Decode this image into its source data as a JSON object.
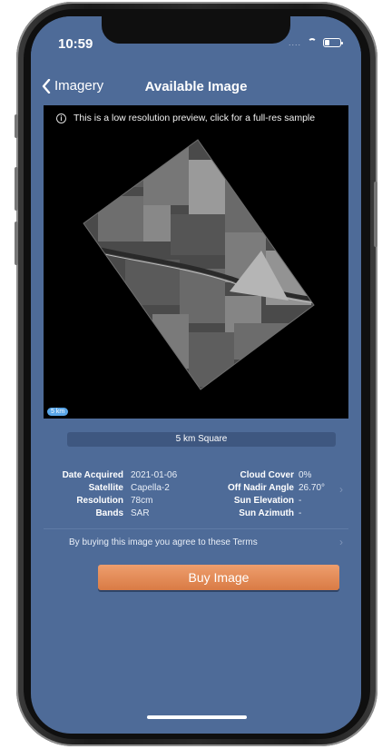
{
  "status_bar": {
    "time": "10:59",
    "signal_dots": "....",
    "icons": [
      "wifi-icon",
      "battery-icon"
    ]
  },
  "nav": {
    "back_label": "Imagery",
    "title": "Available Image"
  },
  "preview": {
    "note": "This is a low resolution preview, click for a full-res sample",
    "scale_badge": "5 km"
  },
  "footprint": {
    "label": "5 km Square"
  },
  "metadata": {
    "left": [
      {
        "label": "Date Acquired",
        "value": "2021-01-06"
      },
      {
        "label": "Satellite",
        "value": "Capella-2"
      },
      {
        "label": "Resolution",
        "value": "78cm"
      },
      {
        "label": "Bands",
        "value": "SAR"
      }
    ],
    "right": [
      {
        "label": "Cloud Cover",
        "value": "0%"
      },
      {
        "label": "Off Nadir Angle",
        "value": "26.70°"
      },
      {
        "label": "Sun Elevation",
        "value": "-"
      },
      {
        "label": "Sun Azimuth",
        "value": "-"
      }
    ]
  },
  "terms": {
    "text": "By buying this image you agree to these Terms"
  },
  "buy_button": {
    "label": "Buy Image"
  },
  "colors": {
    "background": "#4e6b98",
    "button": "#e28a52",
    "badge": "#5aa6e8"
  }
}
